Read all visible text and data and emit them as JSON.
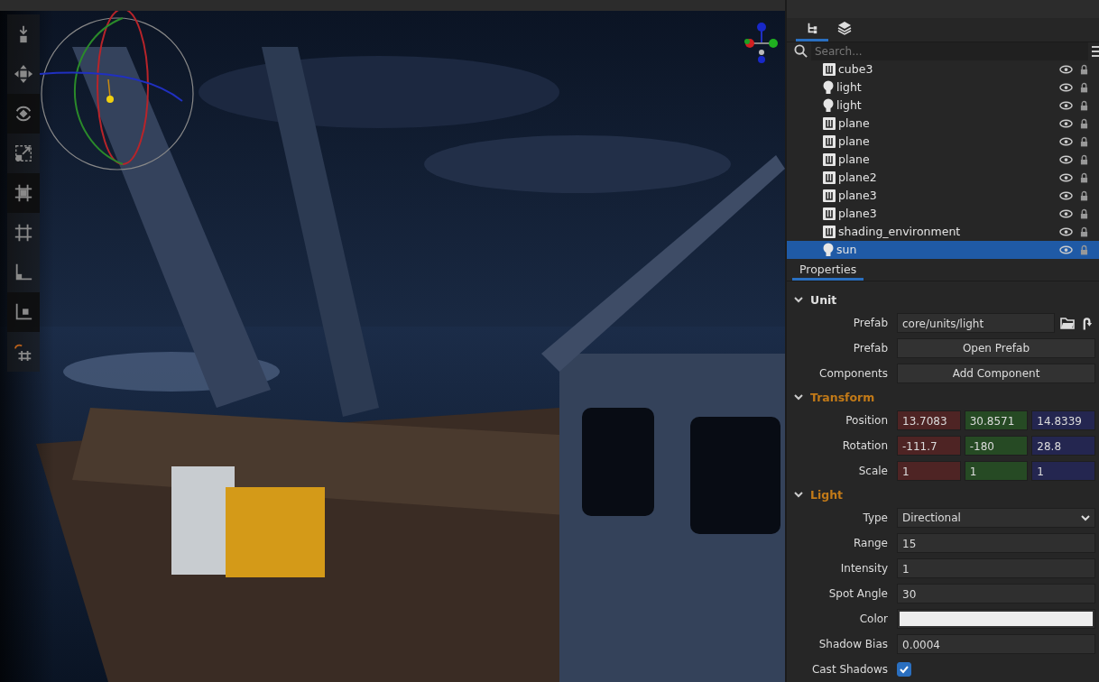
{
  "tools": [
    {
      "kind": "place",
      "selected": false
    },
    {
      "kind": "move",
      "selected": false
    },
    {
      "kind": "rotate",
      "selected": true
    },
    {
      "kind": "scale",
      "selected": false
    },
    {
      "kind": "snap-center",
      "selected": true
    },
    {
      "kind": "grid",
      "selected": false
    },
    {
      "kind": "world",
      "selected": false
    },
    {
      "kind": "local",
      "selected": true
    },
    {
      "kind": "magnet",
      "selected": false
    }
  ],
  "hierarchy": {
    "tabs": [
      {
        "kind": "tree",
        "selected": true
      },
      {
        "kind": "layers",
        "selected": false
      }
    ],
    "search": {
      "placeholder": "Search..."
    },
    "items": [
      {
        "kind": "unit",
        "name": "cube3",
        "selected": false
      },
      {
        "kind": "light",
        "name": "light",
        "selected": false
      },
      {
        "kind": "light",
        "name": "light",
        "selected": false
      },
      {
        "kind": "unit",
        "name": "plane",
        "selected": false
      },
      {
        "kind": "unit",
        "name": "plane",
        "selected": false
      },
      {
        "kind": "unit",
        "name": "plane",
        "selected": false
      },
      {
        "kind": "unit",
        "name": "plane2",
        "selected": false
      },
      {
        "kind": "unit",
        "name": "plane3",
        "selected": false
      },
      {
        "kind": "unit",
        "name": "plane3",
        "selected": false
      },
      {
        "kind": "unit",
        "name": "shading_environment",
        "selected": false
      },
      {
        "kind": "light",
        "name": "sun",
        "selected": true
      }
    ]
  },
  "properties": {
    "tab": "Properties",
    "sections": [
      {
        "title": "Unit",
        "color": "#e0e0e0",
        "expanded": true,
        "rows": [
          {
            "kind": "path",
            "label": "Prefab",
            "value": "core/units/light"
          },
          {
            "kind": "button",
            "label": "Prefab",
            "value": "Open Prefab"
          },
          {
            "kind": "button",
            "label": "Components",
            "value": "Add Component"
          }
        ]
      },
      {
        "title": "Transform",
        "color": "#c27a18",
        "expanded": true,
        "rows": [
          {
            "kind": "vector",
            "label": "Position",
            "values": [
              "13.7083",
              "30.8571",
              "14.8339"
            ]
          },
          {
            "kind": "vector",
            "label": "Rotation",
            "values": [
              "-111.7",
              "-180",
              "28.8"
            ]
          },
          {
            "kind": "vector",
            "label": "Scale",
            "values": [
              "1",
              "1",
              "1"
            ]
          }
        ]
      },
      {
        "title": "Light",
        "color": "#c27a18",
        "expanded": true,
        "rows": [
          {
            "kind": "dropdown",
            "label": "Type",
            "value": "Directional"
          },
          {
            "kind": "text",
            "label": "Range",
            "value": "15"
          },
          {
            "kind": "text",
            "label": "Intensity",
            "value": "1"
          },
          {
            "kind": "text",
            "label": "Spot Angle",
            "value": "30"
          },
          {
            "kind": "color",
            "label": "Color",
            "color": "#eeeeee"
          },
          {
            "kind": "text",
            "label": "Shadow Bias",
            "value": "0.0004"
          },
          {
            "kind": "checkbox",
            "label": "Cast Shadows",
            "checked": true
          }
        ]
      }
    ]
  }
}
